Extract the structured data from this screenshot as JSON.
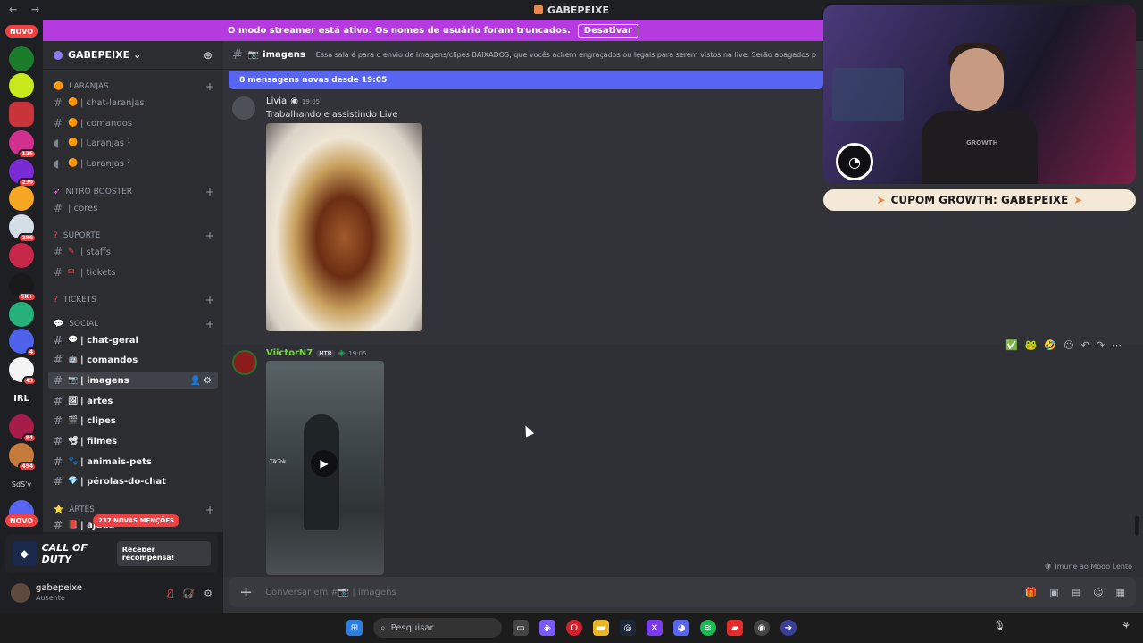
{
  "window": {
    "title": "GABEPEIXE",
    "nav": "← →"
  },
  "streamer_bar": {
    "text": "O modo streamer está ativo. Os nomes de usuário foram truncados.",
    "button": "Desativar"
  },
  "servers": {
    "novo_top": "NOVO",
    "novo_bottom": "NOVO",
    "badges": [
      "125",
      "239",
      "296",
      "5K+",
      "4",
      "43",
      "84",
      "494"
    ],
    "irl_label": "IRL",
    "sdsv_label": "SdS'v"
  },
  "guild": {
    "name": "GABEPEIXE",
    "chevron": "⌄"
  },
  "categories": [
    {
      "name": "LARANJAS",
      "plus": "+"
    },
    {
      "name": "NITRO BOOSTER",
      "plus": "+"
    },
    {
      "name": "SUPORTE",
      "plus": "+"
    },
    {
      "name": "TICKETS",
      "plus": "+"
    },
    {
      "name": "SOCIAL",
      "plus": "+"
    },
    {
      "name": "ARTES",
      "plus": "+"
    }
  ],
  "channels": [
    {
      "name": "| chat-laranjas",
      "icon": "#"
    },
    {
      "name": "| comandos",
      "icon": "#"
    },
    {
      "name": "| Laranjas ¹",
      "icon": "🔊"
    },
    {
      "name": "| Laranjas ²",
      "icon": "🔊"
    },
    {
      "name": "| cores",
      "icon": "#"
    },
    {
      "name": "| staffs",
      "icon": "#"
    },
    {
      "name": "| tickets",
      "icon": "#"
    },
    {
      "name": "| chat-geral",
      "icon": "#"
    },
    {
      "name": "| comandos",
      "icon": "#"
    },
    {
      "name": "| imagens",
      "icon": "#"
    },
    {
      "name": "| artes",
      "icon": "#"
    },
    {
      "name": "| clipes",
      "icon": "#"
    },
    {
      "name": "| filmes",
      "icon": "#"
    },
    {
      "name": "| animais-pets",
      "icon": "#"
    },
    {
      "name": "| pérolas-do-chat",
      "icon": "#"
    },
    {
      "name": "| ajuda",
      "icon": "#"
    }
  ],
  "mentions_badge": "237 NOVAS MENÇÕES",
  "promo": {
    "brand": "CALL OF DUTY",
    "button": "Receber recompensa!"
  },
  "user": {
    "name": "gabepeixe",
    "status": "Ausente"
  },
  "channel_header": {
    "name": "imagens",
    "topic": "Essa sala é para o envio de imagens/clipes BAIXADOS, que vocês achem engraçados ou legais para serem vistos na live. Serão apagados print"
  },
  "new_messages_bar": "8 mensagens novas desde 19:05",
  "messages": [
    {
      "author": "Livia",
      "time": "19:05",
      "text": "Trabalhando e assistindo Live",
      "color": "#f2f3f5"
    },
    {
      "author": "ViictorN7",
      "tag": "HTB",
      "time": "19:05",
      "color": "#6fdc3b"
    }
  ],
  "video": {
    "overlay_text": "TikTok"
  },
  "slowmode_note": "Imune ao Modo Lento",
  "composer": {
    "placeholder": "Conversar em #📷 | imagens"
  },
  "webcam": {
    "shirt_text": "GROWTH"
  },
  "coupon": {
    "text": "CUPOM GROWTH: GABEPEIXE"
  },
  "taskbar": {
    "search_placeholder": "Pesquisar"
  }
}
